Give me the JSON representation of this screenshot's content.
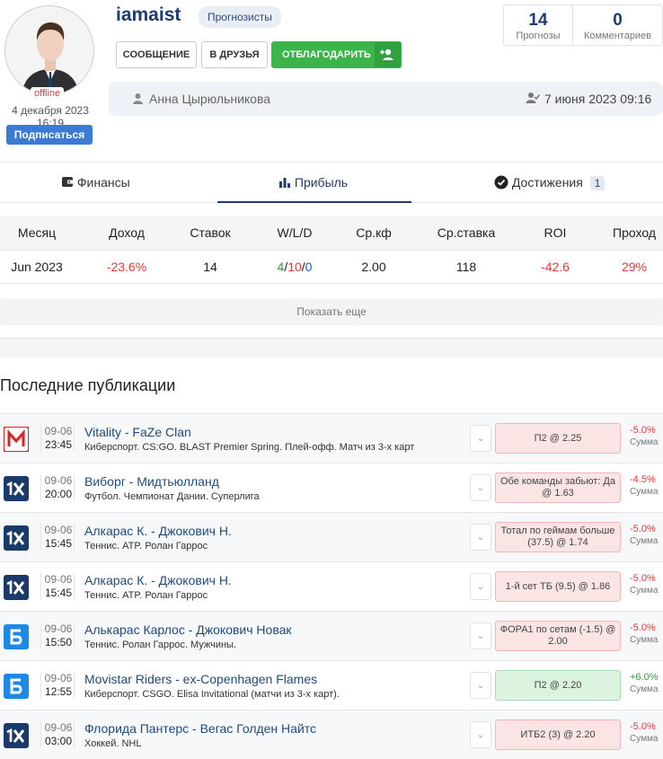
{
  "profile": {
    "username": "iamaist",
    "badge": "Прогнозисты",
    "status": "offline",
    "reg_date": "4 декабря 2023 16:19",
    "subscribe_label": "Подписаться",
    "buttons": {
      "message": "СООБЩЕНИЕ",
      "friends": "В ДРУЗЬЯ",
      "thank": "ОТБЛАГОДАРИТЬ"
    },
    "stats": [
      {
        "value": "14",
        "label": "Прогнозы"
      },
      {
        "value": "0",
        "label": "Комментариев"
      }
    ],
    "author_name": "Анна Цырюльникова",
    "pub_date": "7 июня 2023 09:16"
  },
  "tabs": [
    {
      "label": "Финансы",
      "icon": "wallet-icon"
    },
    {
      "label": "Прибыль",
      "icon": "bar-chart-icon",
      "active": true
    },
    {
      "label": "Достижения",
      "icon": "verified-icon",
      "count": "1"
    }
  ],
  "stats_table": {
    "headers": [
      "Месяц",
      "Доход",
      "Ставок",
      "W/L/D",
      "Ср.кф",
      "Ср.ставка",
      "ROI",
      "Проход"
    ],
    "row": {
      "month": "Jun 2023",
      "income": "-23.6%",
      "bets": "14",
      "w": "4",
      "l": "10",
      "d": "0",
      "avg_coef": "2.00",
      "avg_stake": "118",
      "roi": "-42.6",
      "pass": "29%"
    },
    "show_more": "Показать еще"
  },
  "section_title": "Последние публикации",
  "publications": [
    {
      "bookmaker": "marathon",
      "date": "09-06",
      "time": "23:45",
      "title": "Vitality - FaZe Clan",
      "subtitle": "Киберспорт. CS:GO. BLAST Premier Spring. Плей-офф. Матч из 3-х карт",
      "bet": "П2 @ 2.25",
      "result": "-5.0%",
      "sum_label": "Сумма",
      "win": false
    },
    {
      "bookmaker": "1xbet",
      "date": "09-06",
      "time": "20:00",
      "title": "Виборг - Мидтьюлланд",
      "subtitle": "Футбол. Чемпионат Дании. Суперлига",
      "bet": "Обе команды забьют: Да @ 1.63",
      "result": "-4.5%",
      "sum_label": "Сумма",
      "win": false
    },
    {
      "bookmaker": "1xbet",
      "date": "09-06",
      "time": "15:45",
      "title": "Алкарас К. - Джокович Н.",
      "subtitle": "Теннис. ATP. Ролан Гаррос",
      "bet": "Тотал по геймам больше (37.5) @ 1.74",
      "result": "-5.0%",
      "sum_label": "Сумма",
      "win": false
    },
    {
      "bookmaker": "1xbet",
      "date": "09-06",
      "time": "15:45",
      "title": "Алкарас К. - Джокович Н.",
      "subtitle": "Теннис. ATP. Ролан Гаррос",
      "bet": "1-й сет ТБ (9.5) @ 1.86",
      "result": "-5.0%",
      "sum_label": "Сумма",
      "win": false
    },
    {
      "bookmaker": "betcity",
      "date": "09-06",
      "time": "15:50",
      "title": "Алькарас Карлос - Джокович Новак",
      "subtitle": "Теннис. Ролан Гаррос. Мужчины.",
      "bet": "ФОРА1 по сетам (-1.5) @ 2.00",
      "result": "-5.0%",
      "sum_label": "Сумма",
      "win": false
    },
    {
      "bookmaker": "betcity",
      "date": "09-06",
      "time": "12:55",
      "title": "Movistar Riders - ex-Copenhagen Flames",
      "subtitle": "Киберспорт. CSGO. Elisa Invitational (матчи из 3-х карт).",
      "bet": "П2 @ 2.20",
      "result": "+6.0%",
      "sum_label": "Сумма",
      "win": true
    },
    {
      "bookmaker": "1xbet",
      "date": "09-06",
      "time": "03:00",
      "title": "Флорида Пантерс - Вегас Голден Найтс",
      "subtitle": "Хоккей. NHL",
      "bet": "ИТБ2 (3) @ 2.20",
      "result": "-5.0%",
      "sum_label": "Сумма",
      "win": false
    }
  ],
  "colors": {
    "accent": "#1f3b73",
    "loss": "#e53935",
    "win": "#2e9c3f",
    "thank_button": "#3bb54a",
    "subscribe_button": "#3a7bd5"
  }
}
